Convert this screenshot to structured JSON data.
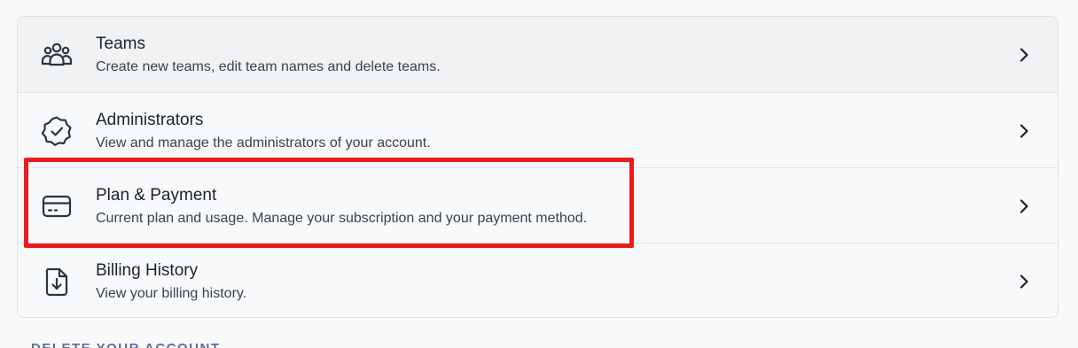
{
  "settings": {
    "rows": [
      {
        "icon": "team-group-icon",
        "title": "Teams",
        "description": "Create new teams, edit team names and delete teams."
      },
      {
        "icon": "verified-badge-icon",
        "title": "Administrators",
        "description": "View and manage the administrators of your account."
      },
      {
        "icon": "credit-card-icon",
        "title": "Plan & Payment",
        "description": "Current plan and usage. Manage your subscription and your payment method."
      },
      {
        "icon": "file-download-icon",
        "title": "Billing History",
        "description": "View your billing history."
      }
    ]
  },
  "danger_zone": {
    "heading": "DELETE YOUR ACCOUNT"
  },
  "colors": {
    "highlight": "#ee1b1b",
    "text": "#1d232b",
    "muted": "#3a424d",
    "section_heading": "#5a6f9a"
  }
}
